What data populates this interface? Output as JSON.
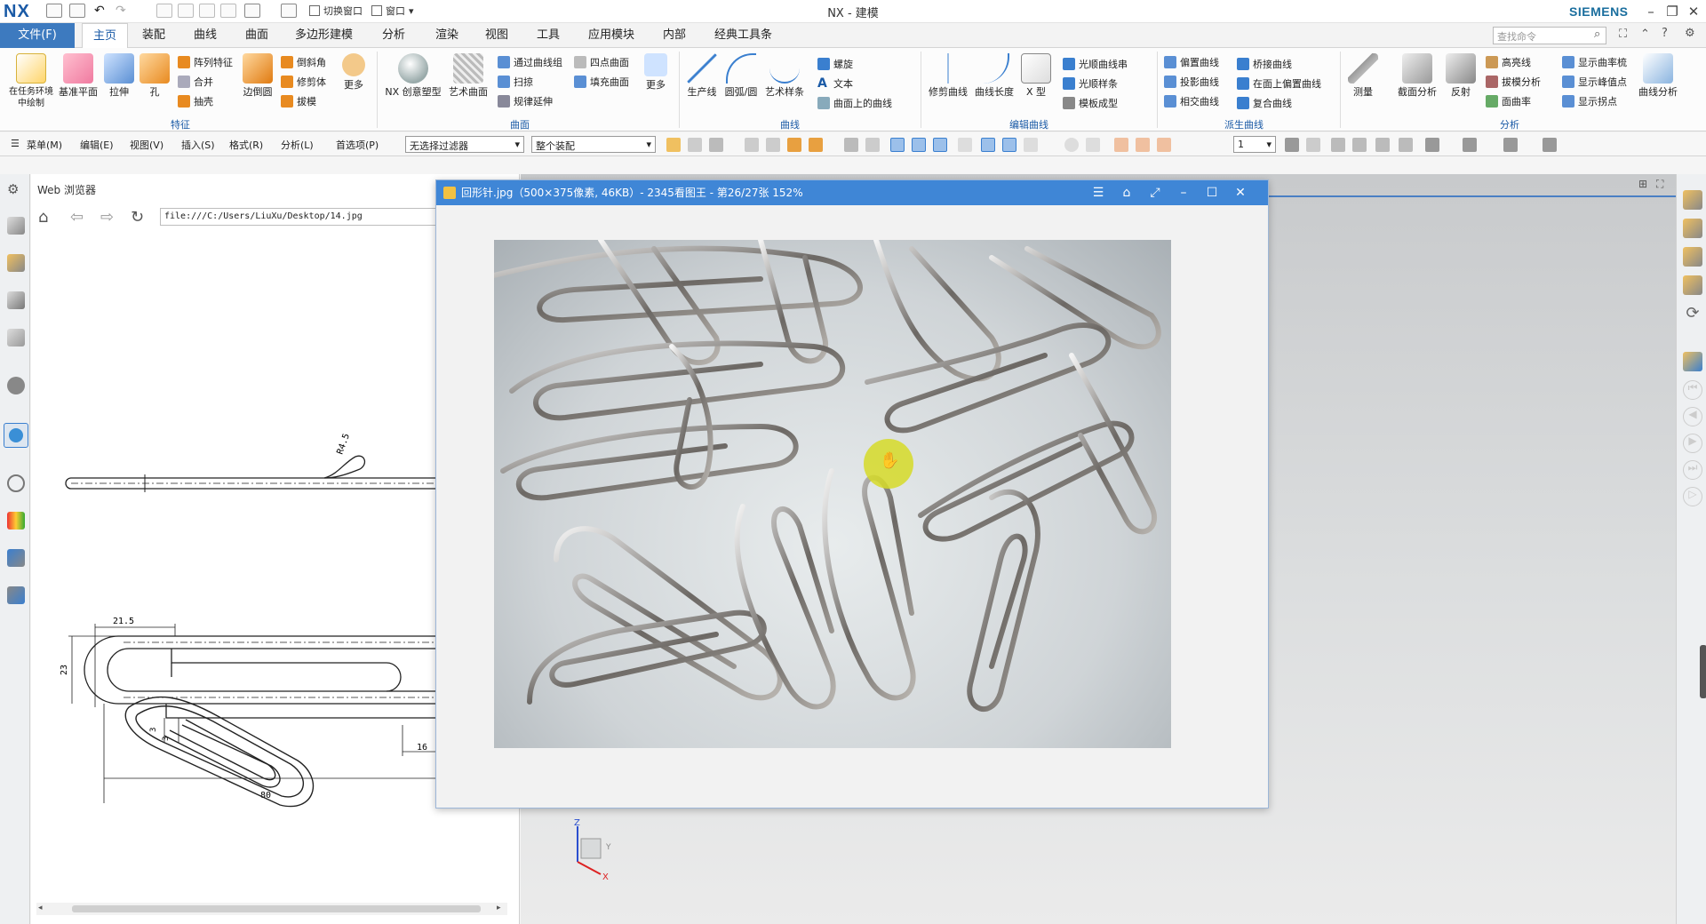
{
  "titlebar": {
    "logo": "NX",
    "switch_window": "切换窗口",
    "window_menu": "窗口",
    "app_title": "NX - 建模",
    "brand": "SIEMENS"
  },
  "menubar": {
    "file": "文件(F)",
    "tabs": [
      "主页",
      "装配",
      "曲线",
      "曲面",
      "多边形建模",
      "分析",
      "渲染",
      "视图",
      "工具",
      "应用模块",
      "内部",
      "经典工具条"
    ],
    "search_placeholder": "查找命令"
  },
  "ribbon": {
    "feature": {
      "buttons": [
        "在任务环境中绘制",
        "基准平面",
        "拉伸",
        "孔",
        "边倒圆",
        "更多"
      ],
      "small": [
        "阵列特征",
        "合并",
        "抽壳",
        "倒斜角",
        "修剪体",
        "拔模"
      ],
      "group_label": "特征"
    },
    "surface": {
      "buttons": [
        "NX 创意塑型",
        "艺术曲面",
        "更多"
      ],
      "small": [
        "通过曲线组",
        "扫掠",
        "规律延伸",
        "四点曲面",
        "填充曲面"
      ],
      "group_label": "曲面"
    },
    "curve": {
      "buttons": [
        "生产线",
        "圆弧/圆",
        "艺术样条"
      ],
      "small": [
        "螺旋",
        "文本",
        "曲面上的曲线"
      ],
      "group_label": "曲线"
    },
    "edit_curve": {
      "buttons": [
        "修剪曲线",
        "曲线长度",
        "X 型"
      ],
      "small": [
        "光顺曲线串",
        "光顺样条",
        "模板成型"
      ],
      "group_label": "编辑曲线"
    },
    "derived_curve": {
      "small": [
        "偏置曲线",
        "投影曲线",
        "相交曲线",
        "桥接曲线",
        "在面上偏置曲线",
        "复合曲线"
      ],
      "group_label": "派生曲线"
    },
    "analysis": {
      "buttons": [
        "测量",
        "截面分析",
        "反射",
        "曲线分析"
      ],
      "small": [
        "高亮线",
        "拔模分析",
        "面曲率",
        "显示曲率梳",
        "显示峰值点",
        "显示拐点"
      ],
      "group_label": "分析"
    }
  },
  "toolbar2": {
    "menus": [
      "菜单(M)",
      "编辑(E)",
      "视图(V)",
      "插入(S)",
      "格式(R)",
      "分析(L)",
      "首选项(P)"
    ],
    "selection_filter": "无选择过滤器",
    "assembly_scope": "整个装配",
    "count": "1"
  },
  "webpanel": {
    "title": "Web 浏览器",
    "url": "file:///C:/Users/LiuXu/Desktop/14.jpg",
    "drawing_dims": [
      "R4.5",
      "21.5",
      "23",
      "3",
      "3",
      "16",
      "80"
    ]
  },
  "viewer": {
    "title": "回形针.jpg（500×375像素, 46KB）- 2345看图王 - 第26/27张 152%"
  },
  "axes": {
    "z": "Z",
    "y": "Y",
    "x": "X"
  },
  "colors": {
    "accent": "#3d7abf",
    "viewer_title": "#3f86d6",
    "cursor_highlight": "#d6db28"
  }
}
